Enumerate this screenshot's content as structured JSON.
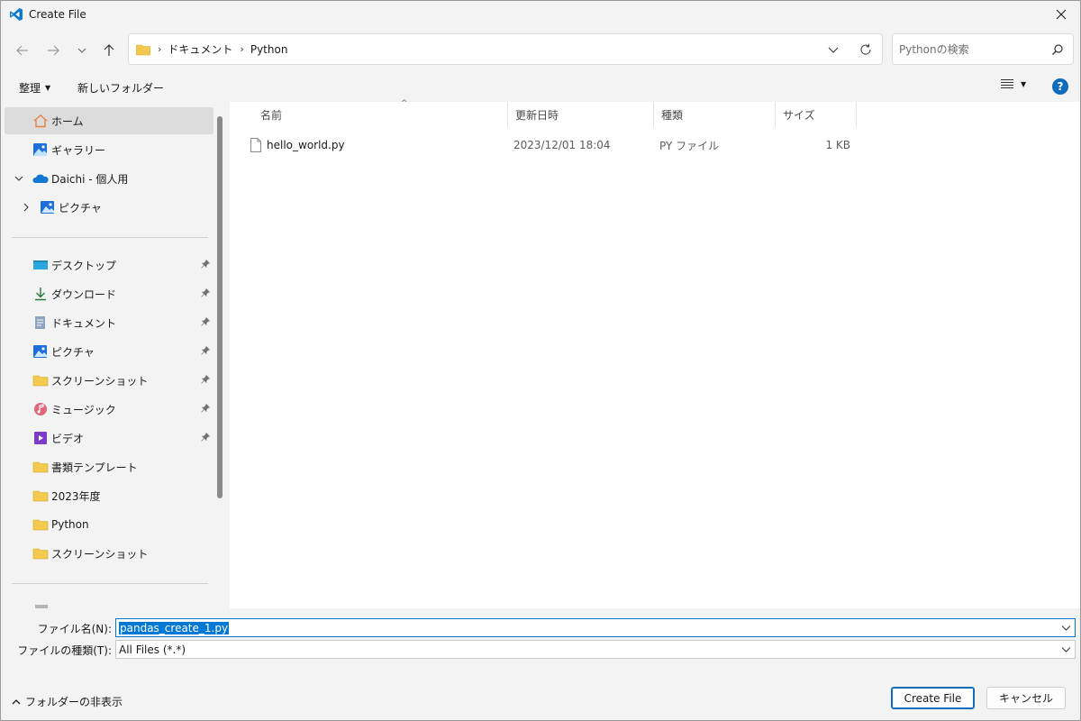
{
  "window": {
    "title": "Create File"
  },
  "nav": {
    "breadcrumb": [
      "ドキュメント",
      "Python"
    ],
    "search_placeholder": "Pythonの検索"
  },
  "toolbar": {
    "organize": "整理",
    "new_folder": "新しいフォルダー"
  },
  "sidebar": {
    "top": [
      {
        "label": "ホーム",
        "icon": "home-icon"
      },
      {
        "label": "ギャラリー",
        "icon": "gallery-icon"
      },
      {
        "label": "Daichi - 個人用",
        "icon": "onedrive-cloud-icon"
      },
      {
        "label": "ピクチャ",
        "icon": "pictures-icon"
      }
    ],
    "pinned": [
      {
        "label": "デスクトップ",
        "icon": "desktop-icon"
      },
      {
        "label": "ダウンロード",
        "icon": "download-icon"
      },
      {
        "label": "ドキュメント",
        "icon": "documents-icon"
      },
      {
        "label": "ピクチャ",
        "icon": "pictures-icon"
      },
      {
        "label": "スクリーンショット",
        "icon": "folder-icon"
      },
      {
        "label": "ミュージック",
        "icon": "music-icon"
      },
      {
        "label": "ビデオ",
        "icon": "video-icon"
      }
    ],
    "folders": [
      {
        "label": "書類テンプレート",
        "icon": "folder-icon"
      },
      {
        "label": "2023年度",
        "icon": "folder-icon"
      },
      {
        "label": "Python",
        "icon": "folder-icon"
      },
      {
        "label": "スクリーンショット",
        "icon": "folder-icon"
      }
    ]
  },
  "columns": {
    "name": "名前",
    "modified": "更新日時",
    "type": "種類",
    "size": "サイズ"
  },
  "files": [
    {
      "name": "hello_world.py",
      "modified": "2023/12/01 18:04",
      "type": "PY ファイル",
      "size": "1 KB"
    }
  ],
  "form": {
    "filename_label": "ファイル名(N):",
    "filename_value": "pandas_create_1.py",
    "filetype_label": "ファイルの種類(T):",
    "filetype_value": "All Files (*.*)"
  },
  "footer": {
    "hide_folders": "フォルダーの非表示",
    "create_button": "Create File",
    "cancel_button": "キャンセル"
  },
  "colors": {
    "accent": "#0078d4",
    "selected_nav": "#dcdcdc",
    "folder": "#f2c94c"
  }
}
